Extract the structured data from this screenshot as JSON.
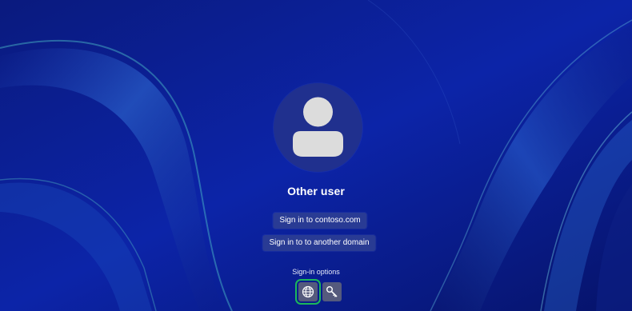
{
  "login": {
    "username": "Other user",
    "buttons": {
      "sign_in_contoso": "Sign in to contoso.com",
      "sign_in_other_domain": "Sign in to to another domain"
    },
    "sign_in_options": {
      "label": "Sign-in options",
      "options": [
        {
          "icon": "globe-icon",
          "selected": true
        },
        {
          "icon": "key-icon",
          "selected": false
        }
      ]
    }
  },
  "colors": {
    "background": "#0a1d8f",
    "avatar_circle": "#20308e",
    "button_bg": "#2d3e94",
    "selection_outline": "#1cb75a"
  }
}
